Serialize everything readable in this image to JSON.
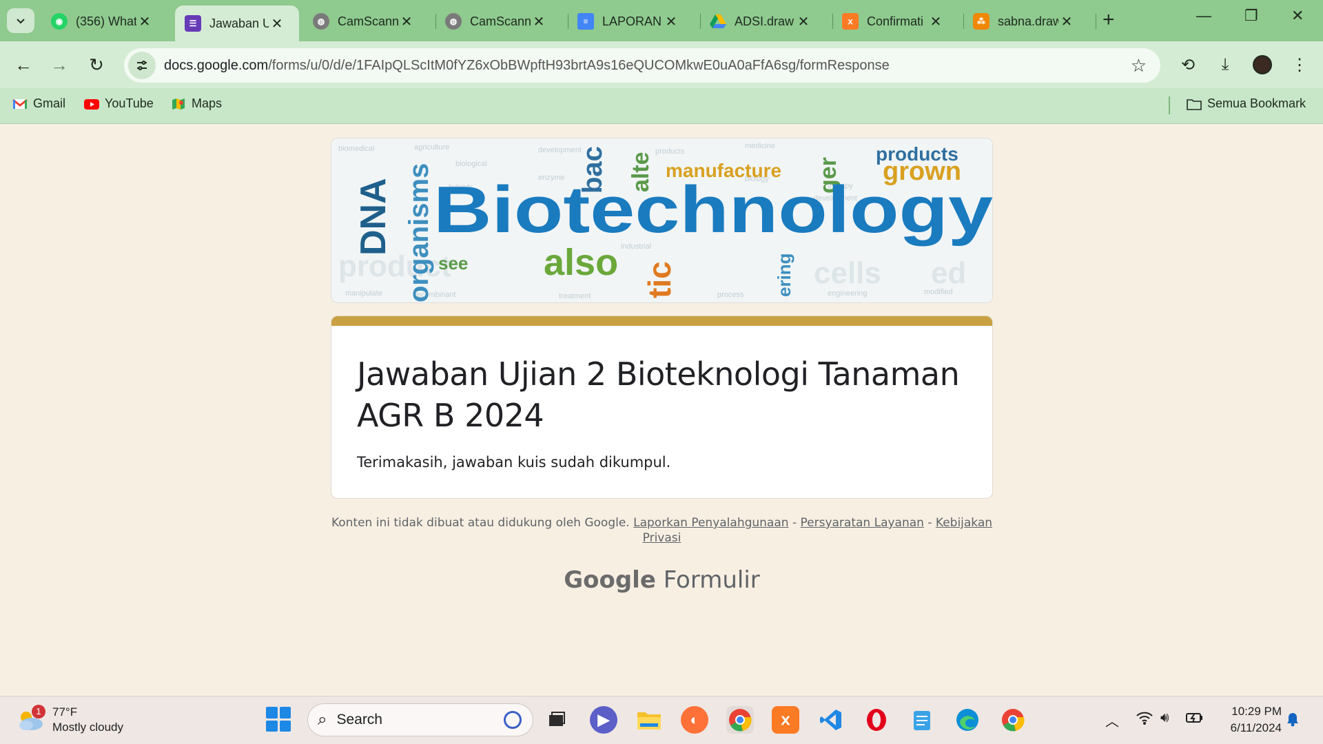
{
  "browser": {
    "tabs": [
      {
        "label": "(356) What",
        "icon": "whatsapp-icon",
        "color": "#25d366",
        "active": false
      },
      {
        "label": "Jawaban U",
        "icon": "google-forms-icon",
        "color": "#673ab7",
        "active": true
      },
      {
        "label": "CamScann",
        "icon": "globe-icon",
        "color": "#7a7a7a",
        "active": false
      },
      {
        "label": "CamScann",
        "icon": "globe-icon",
        "color": "#7a7a7a",
        "active": false
      },
      {
        "label": "LAPORAN",
        "icon": "google-docs-icon",
        "color": "#4285f4",
        "active": false
      },
      {
        "label": "ADSI.draw",
        "icon": "google-drive-icon",
        "color": "#fbbc04",
        "active": false
      },
      {
        "label": "Confirmati",
        "icon": "xampp-icon",
        "color": "#fb7a24",
        "active": false
      },
      {
        "label": "sabna.draw",
        "icon": "drawio-icon",
        "color": "#f08705",
        "active": false
      }
    ],
    "url_host": "docs.google.com",
    "url_path": "/forms/u/0/d/e/1FAIpQLScItM0fYZ6xObBWpftH93brtA9s16eQUCOMkwE0uA0aFfA6sg/formResponse",
    "bookmarks": [
      {
        "label": "Gmail",
        "icon": "gmail-icon"
      },
      {
        "label": "YouTube",
        "icon": "youtube-icon"
      },
      {
        "label": "Maps",
        "icon": "maps-icon"
      }
    ],
    "all_bookmarks_label": "Semua Bookmark"
  },
  "form": {
    "banner_word": "Biotechnology",
    "banner_words": [
      "DNA",
      "organisms",
      "bac",
      "alte",
      "products",
      "grown",
      "manufacture",
      "ger",
      "see",
      "also",
      "tic",
      "cells",
      "ering"
    ],
    "accent_color": "#c9a142",
    "title": "Jawaban Ujian 2  Bioteknologi Tanaman AGR B 2024",
    "message": "Terimakasih, jawaban kuis sudah dikumpul.",
    "disclaimer_text": "Konten ini tidak dibuat atau didukung oleh Google.",
    "link_report": "Laporkan Penyalahgunaan",
    "link_terms": "Persyaratan Layanan",
    "link_privacy": "Kebijakan Privasi",
    "sep": "-",
    "logo_google": "Google",
    "logo_forms": "Formulir"
  },
  "taskbar": {
    "weather_badge": "1",
    "weather_temp": "77°F",
    "weather_desc": "Mostly cloudy",
    "search_label": "Search",
    "time": "10:29 PM",
    "date": "6/11/2024"
  }
}
